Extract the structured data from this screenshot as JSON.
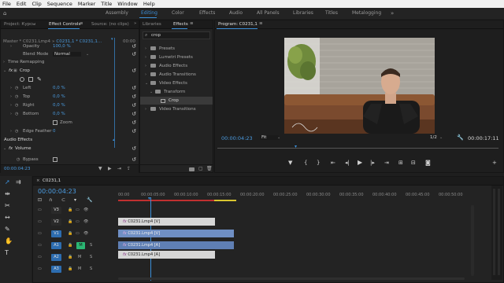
{
  "menu": [
    "File",
    "Edit",
    "Clip",
    "Sequence",
    "Marker",
    "Title",
    "Window",
    "Help"
  ],
  "workspaces": [
    {
      "label": "Assembly",
      "active": false
    },
    {
      "label": "Editing",
      "active": true
    },
    {
      "label": "Color",
      "active": false
    },
    {
      "label": "Effects",
      "active": false
    },
    {
      "label": "Audio",
      "active": false
    },
    {
      "label": "All Panels",
      "active": false
    },
    {
      "label": "Libraries",
      "active": false
    },
    {
      "label": "Titles",
      "active": false
    },
    {
      "label": "Metalogging",
      "active": false
    }
  ],
  "effect_controls": {
    "tabs": [
      "Project: Курсы",
      "Effect Controls",
      "Source: (no clips)"
    ],
    "menu_glyph": "≡",
    "source_menu": "»",
    "master": "Master * C0231.Lmp4",
    "master_sep": "»",
    "clip": "C0231,1 * C0231,1...",
    "mini_time": "00:00",
    "rows": [
      {
        "label": "Opacity",
        "value": "100,0 %",
        "cut": true
      },
      {
        "label": "Blend Mode",
        "value": "Normal"
      },
      {
        "label": "Time Remapping",
        "value": ""
      },
      {
        "label": "Crop",
        "value": ""
      },
      {
        "label": "Left",
        "value": "0,0 %"
      },
      {
        "label": "Top",
        "value": "0,0 %"
      },
      {
        "label": "Right",
        "value": "0,0 %"
      },
      {
        "label": "Bottom",
        "value": "0,0 %"
      },
      {
        "label": "Zoom",
        "value": ""
      },
      {
        "label": "Edge Feather",
        "value": "0"
      },
      {
        "label": "Audio Effects",
        "value": ""
      },
      {
        "label": "Volume",
        "value": ""
      },
      {
        "label": "Bypass",
        "value": ""
      }
    ],
    "fx_tag": "fx",
    "crop_fx": "fx",
    "volume_fx": "fx",
    "timecode": "00:00:04:23"
  },
  "effects_panel": {
    "tabs": [
      "Libraries",
      "Effects"
    ],
    "tab_menu": "≡",
    "search_value": "crop",
    "tree": [
      {
        "label": "Presets",
        "indent": 0
      },
      {
        "label": "Lumetri Presets",
        "indent": 0
      },
      {
        "label": "Audio Effects",
        "indent": 0
      },
      {
        "label": "Audio Transitions",
        "indent": 0
      },
      {
        "label": "Video Effects",
        "indent": 0
      },
      {
        "label": "Transform",
        "indent": 1
      },
      {
        "label": "Crop",
        "indent": 2
      },
      {
        "label": "Video Transitions",
        "indent": 0
      }
    ]
  },
  "program": {
    "title": "Program: C0231,1",
    "menu": "≡",
    "timecode": "00:00:04:23",
    "fit": "Fit",
    "quality": "1/2",
    "duration": "00:00:17:11"
  },
  "timeline": {
    "tab": "C0231,1",
    "timecode": "00:00:04:23",
    "ruler": [
      "00:00",
      "00:00:05:00",
      "00:00:10:00",
      "00:00:15:00",
      "00:00:20:00",
      "00:00:25:00",
      "00:00:30:00",
      "00:00:35:00",
      "00:00:40:00",
      "00:00:45:00",
      "00:00:50:00"
    ],
    "tracks": [
      {
        "id": "V3",
        "kind": "video"
      },
      {
        "id": "V2",
        "kind": "video"
      },
      {
        "id": "V1",
        "kind": "video",
        "active": true
      },
      {
        "id": "A1",
        "kind": "audio",
        "active": true,
        "m": "M",
        "s": "S"
      },
      {
        "id": "A2",
        "kind": "audio",
        "active": true,
        "m": "M",
        "s": "S"
      },
      {
        "id": "A3",
        "kind": "audio",
        "active": true,
        "m": "M",
        "s": "S"
      }
    ],
    "clips": [
      {
        "label": "C0231.Lmp4 [V]",
        "track": "V2",
        "fx": "fx"
      },
      {
        "label": "C0231.Lmp4 [V]",
        "track": "V1",
        "fx": "fx"
      },
      {
        "label": "C0231.Lmp4 [A]",
        "track": "A1",
        "fx": "fx"
      },
      {
        "label": "C0231.Lmp4 [A]",
        "track": "A2",
        "fx": "fx"
      }
    ]
  },
  "colors": {
    "accent": "#3b8fd9",
    "clip_video": "#6f8fc4",
    "clip_gray": "#b8b8b8",
    "audio_green": "#2bb673"
  }
}
